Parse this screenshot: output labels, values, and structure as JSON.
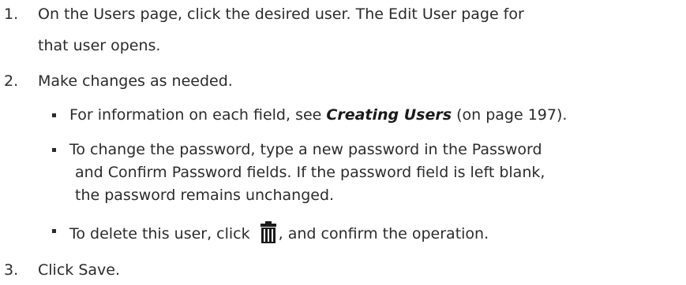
{
  "steps": [
    {
      "number": "1.",
      "line1": "On the Users page, click the desired user. The Edit User page for",
      "line2": "that user opens."
    },
    {
      "number": "2.",
      "text": "Make changes as needed.",
      "bullets": {
        "field_info": {
          "prefix": "For information on each field, see ",
          "link": "Creating Users",
          "suffix": " (on page 197)."
        },
        "password": {
          "line1": "To change the password, type a new password in the Password",
          "line2": "and Confirm Password fields. If the password field is left blank,",
          "line3": "the password remains unchanged."
        },
        "delete": {
          "prefix": "To delete this user, click ",
          "icon": "trash-icon",
          "suffix": ", and confirm the operation."
        }
      }
    },
    {
      "number": "3.",
      "text": "Click Save."
    }
  ]
}
